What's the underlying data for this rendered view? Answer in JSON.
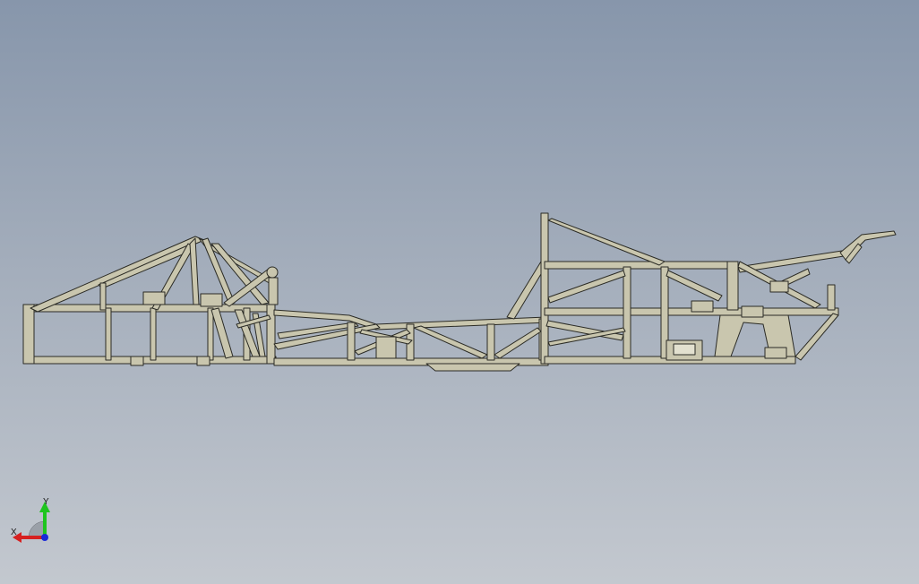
{
  "viewport": {
    "background_top": "#8796ab",
    "background_bottom": "#c3c8cf",
    "model_color": "#c9c6ae",
    "model_edge_color": "#2b2b25"
  },
  "model": {
    "name_icon": "chassis-frame-model"
  },
  "triad": {
    "x_label": "X",
    "y_label": "Y",
    "x_color": "#d62020",
    "y_color": "#1ec51e",
    "z_color": "#1a2ad8",
    "icon": "coordinate-triad-icon"
  }
}
